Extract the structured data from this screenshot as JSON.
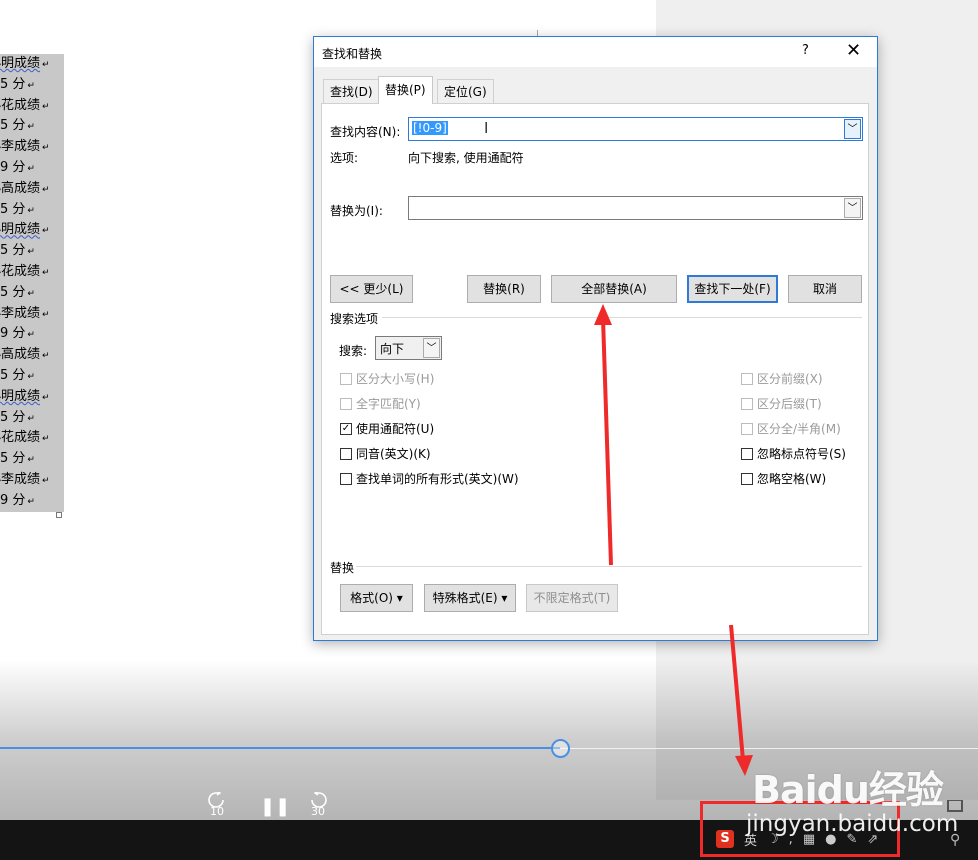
{
  "document": {
    "lines": [
      {
        "text": "小明成绩",
        "squiggle": true
      },
      {
        "text": "5 分"
      },
      {
        "text": "小花成绩"
      },
      {
        "text": "5 分"
      },
      {
        "text": "小李成绩"
      },
      {
        "text": "9 分"
      },
      {
        "text": "小高成绩"
      },
      {
        "text": "5 分"
      },
      {
        "text": "小明成绩",
        "squiggle": true
      },
      {
        "text": "5 分"
      },
      {
        "text": "小花成绩"
      },
      {
        "text": "5 分"
      },
      {
        "text": "小李成绩"
      },
      {
        "text": "9 分"
      },
      {
        "text": "小高成绩"
      },
      {
        "text": "5 分"
      },
      {
        "text": "小明成绩",
        "squiggle": true
      },
      {
        "text": "5 分"
      },
      {
        "text": "小花成绩"
      },
      {
        "text": "5 分"
      },
      {
        "text": "小李成绩"
      },
      {
        "text": "9 分"
      }
    ],
    "paragraph_mark": "↵"
  },
  "dialog": {
    "title": "查找和替换",
    "help": "?",
    "close": "✕",
    "tabs": [
      {
        "label": "查找(D)",
        "active": false
      },
      {
        "label": "替换(P)",
        "active": true
      },
      {
        "label": "定位(G)",
        "active": false
      }
    ],
    "find_label": "查找内容(N):",
    "find_value": "[!0-9]",
    "options_label": "选项:",
    "options_value": "向下搜索, 使用通配符",
    "replace_label": "替换为(I):",
    "replace_value": "",
    "buttons": {
      "less": "<< 更少(L)",
      "replace": "替换(R)",
      "replace_all": "全部替换(A)",
      "find_next": "查找下一处(F)",
      "cancel": "取消"
    },
    "search_options_header": "搜索选项",
    "search_label": "搜索:",
    "search_value": "向下",
    "checkboxes_left": [
      {
        "label": "区分大小写(H)",
        "checked": false,
        "enabled": false
      },
      {
        "label": "全字匹配(Y)",
        "checked": false,
        "enabled": false
      },
      {
        "label": "使用通配符(U)",
        "checked": true,
        "enabled": true
      },
      {
        "label": "同音(英文)(K)",
        "checked": false,
        "enabled": true
      },
      {
        "label": "查找单词的所有形式(英文)(W)",
        "checked": false,
        "enabled": true
      }
    ],
    "checkboxes_right": [
      {
        "label": "区分前缀(X)",
        "checked": false,
        "enabled": false
      },
      {
        "label": "区分后缀(T)",
        "checked": false,
        "enabled": false
      },
      {
        "label": "区分全/半角(M)",
        "checked": false,
        "enabled": false
      },
      {
        "label": "忽略标点符号(S)",
        "checked": false,
        "enabled": true
      },
      {
        "label": "忽略空格(W)",
        "checked": false,
        "enabled": true
      }
    ],
    "replace_section_header": "替换",
    "format_button": "格式(O) ▾",
    "special_button": "特殊格式(E) ▾",
    "no_format_button": "不限定格式(T)"
  },
  "video": {
    "progress_fraction": 0.573,
    "rewind_label": "10",
    "forward_label": "30",
    "pause_icon": "pause-icon"
  },
  "taskbar": {
    "ime_logo": "S",
    "ime_lang": "英",
    "ime_icons": [
      "moon-icon",
      "punctuation-icon",
      "keyboard-icon",
      "user-icon",
      "wrench-icon",
      "share-icon"
    ]
  },
  "watermark": {
    "brand": "Baidu经验",
    "url": "jingyan.baidu.com"
  },
  "colors": {
    "accent": "#2f7ad6",
    "annotation_red": "#ee2a2a",
    "selection": "#3399ff",
    "progress": "#4a90e2"
  }
}
